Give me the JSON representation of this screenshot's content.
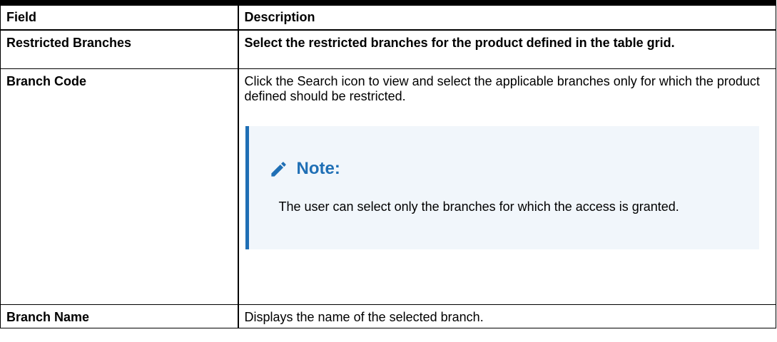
{
  "table": {
    "headers": {
      "field": "Field",
      "description": "Description"
    },
    "rows": [
      {
        "field": "Restricted Branches",
        "description": "Select the restricted branches for the product defined in the table grid."
      },
      {
        "field": "Branch Code",
        "description": "Click the Search icon to view and select the applicable branches only for which the product defined should be restricted.",
        "note": {
          "icon": "pencil-icon",
          "title": "Note:",
          "text": "The user can select only the branches for which the access is granted.",
          "accent_color": "#1f6fb5",
          "background_color": "#f1f6fb"
        }
      },
      {
        "field": "Branch Name",
        "description": "Displays the name of the selected branch."
      }
    ]
  }
}
